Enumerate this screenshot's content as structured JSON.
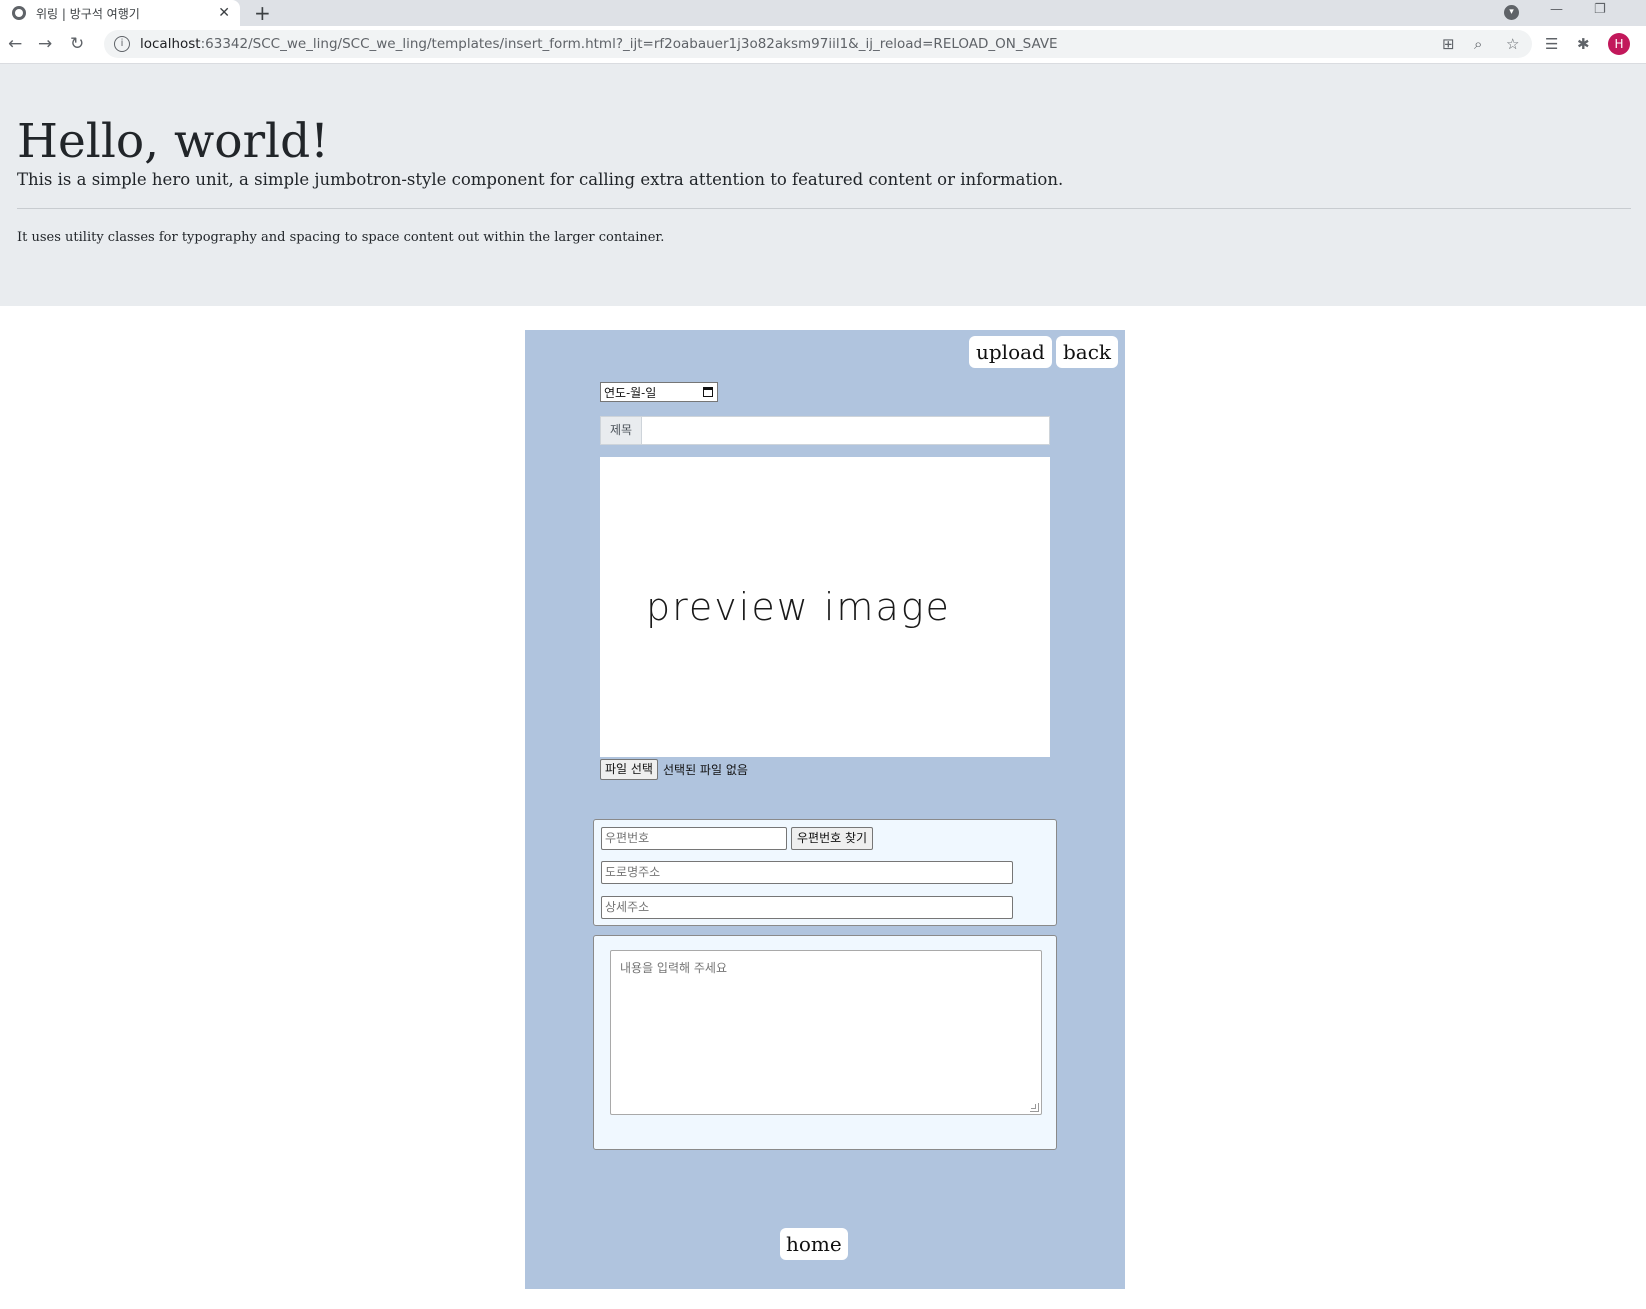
{
  "browser": {
    "tab_title": "위링 | 방구석 여행기",
    "tab_close": "✕",
    "new_tab": "+",
    "url_host": "localhost",
    "url_rest": ":63342/SCC_we_ling/SCC_we_ling/templates/insert_form.html?_ijt=rf2oabauer1j3o82aksm97iil1&_ij_reload=RELOAD_ON_SAVE",
    "profile_initial": "H"
  },
  "hero": {
    "title": "Hello, world!",
    "lead": "This is a simple hero unit, a simple jumbotron-style component for calling extra attention to featured content or information.",
    "text": "It uses utility classes for typography and spacing to space content out within the larger container."
  },
  "form": {
    "upload_label": "upload",
    "back_label": "back",
    "date_placeholder": "연도-월-일",
    "title_addon": "제목",
    "title_value": "",
    "preview_text": "preview image",
    "file_button": "파일 선택",
    "file_status": "선택된 파일 없음",
    "postcode_placeholder": "우편번호",
    "postcode_button": "우편번호 찾기",
    "road_address_placeholder": "도로명주소",
    "detail_address_placeholder": "상세주소",
    "content_placeholder": "내용을 입력해 주세요",
    "home_label": "home"
  },
  "colors": {
    "panel_bg": "#b0c4de",
    "jumbotron_bg": "#e9ecef",
    "box_bg": "#f0f8ff",
    "avatar_bg": "#c2185b"
  }
}
